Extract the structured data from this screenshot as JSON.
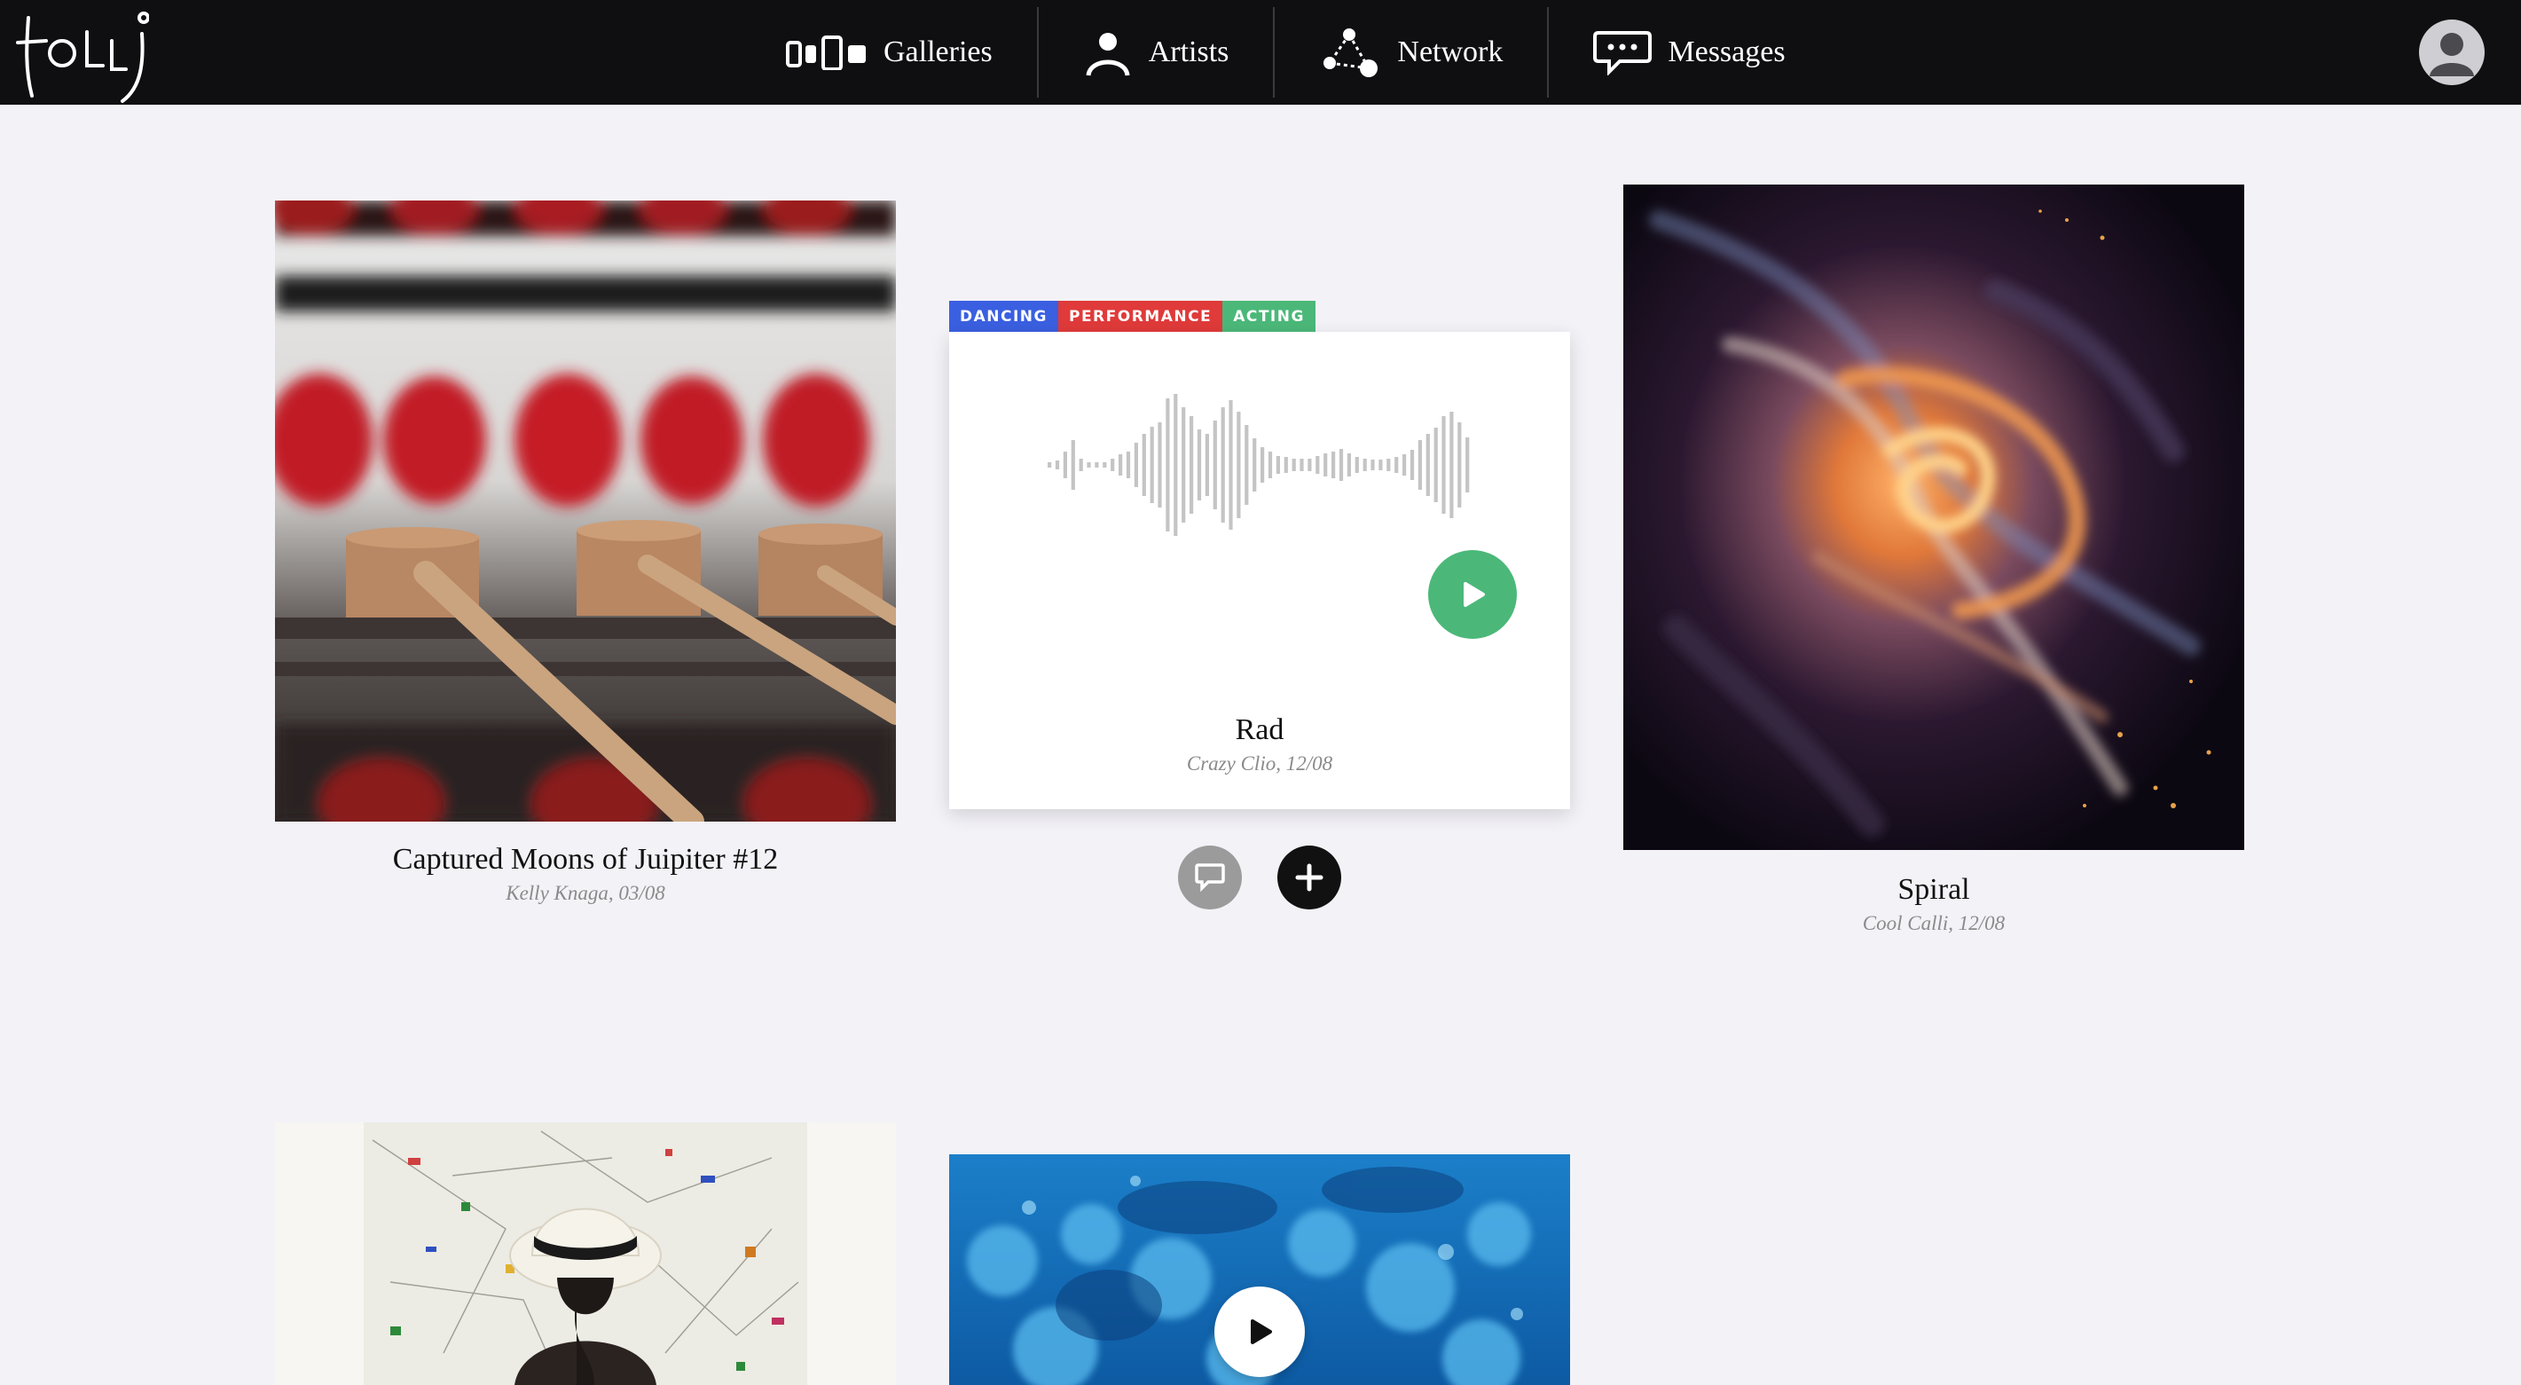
{
  "app": {
    "logo_text": "tolli"
  },
  "nav": {
    "items": [
      {
        "label": "Galleries",
        "icon": "galleries-icon"
      },
      {
        "label": "Artists",
        "icon": "artist-icon"
      },
      {
        "label": "Network",
        "icon": "network-icon"
      },
      {
        "label": "Messages",
        "icon": "messages-icon"
      }
    ],
    "avatar_icon": "user-avatar-icon"
  },
  "cards": [
    {
      "title": "Captured Moons of Juipiter #12",
      "byline": "Kelly Knaga, 03/08",
      "type": "image"
    },
    {
      "title": "Rad",
      "byline": "Crazy Clio, 12/08",
      "type": "audio",
      "tags": [
        {
          "label": "DANCING",
          "color": "#3a5fe0"
        },
        {
          "label": "PERFORMANCE",
          "color": "#e03a3a"
        },
        {
          "label": "ACTING",
          "color": "#4bb879"
        }
      ]
    },
    {
      "title": "Spiral",
      "byline": "Cool Calli, 12/08",
      "type": "image"
    },
    {
      "title": "",
      "byline": "",
      "type": "image"
    },
    {
      "title": "",
      "byline": "",
      "type": "video"
    }
  ],
  "colors": {
    "topbar": "#0f0e11",
    "background": "#f3f2f7",
    "play_green": "#4bb879",
    "comment_button": "#9b9b9b",
    "add_button": "#111111"
  }
}
